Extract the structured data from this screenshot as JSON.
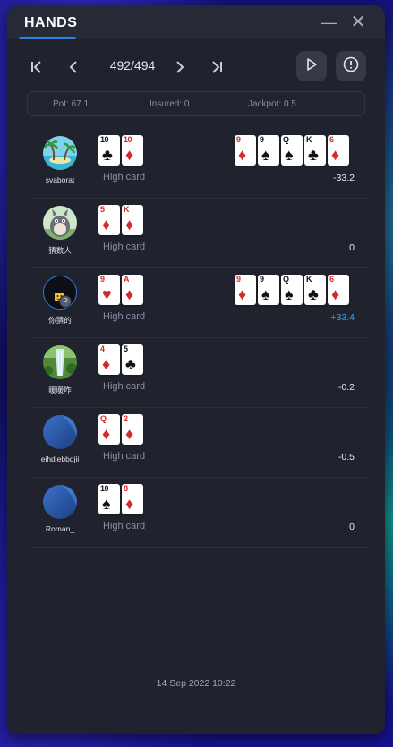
{
  "window": {
    "title": "HANDS"
  },
  "nav": {
    "counter": "492/494"
  },
  "info": {
    "pot": "Pot: 67.1",
    "insured": "Insured: 0",
    "jackpot": "Jackpot: 0.5"
  },
  "rows": [
    {
      "name": "svaborat",
      "hand": "High card",
      "result": "-33.2",
      "hole": [
        {
          "rank": "10",
          "suit": "♣",
          "color": "black"
        },
        {
          "rank": "10",
          "suit": "♦",
          "color": "red"
        }
      ],
      "board": [
        {
          "rank": "9",
          "suit": "♦",
          "color": "red"
        },
        {
          "rank": "9",
          "suit": "♠",
          "color": "black"
        },
        {
          "rank": "Q",
          "suit": "♠",
          "color": "black"
        },
        {
          "rank": "K",
          "suit": "♣",
          "color": "black"
        },
        {
          "rank": "6",
          "suit": "♦",
          "color": "red"
        }
      ]
    },
    {
      "name": "猜数人",
      "hand": "High card",
      "result": "0",
      "hole": [
        {
          "rank": "5",
          "suit": "♦",
          "color": "red"
        },
        {
          "rank": "K",
          "suit": "♦",
          "color": "red"
        }
      ],
      "board": []
    },
    {
      "name": "你猜的",
      "hand": "High card",
      "result": "+33.4",
      "badge": "D",
      "hole": [
        {
          "rank": "9",
          "suit": "♥",
          "color": "red"
        },
        {
          "rank": "A",
          "suit": "♦",
          "color": "red"
        }
      ],
      "board": [
        {
          "rank": "9",
          "suit": "♦",
          "color": "red"
        },
        {
          "rank": "9",
          "suit": "♠",
          "color": "black"
        },
        {
          "rank": "Q",
          "suit": "♠",
          "color": "black"
        },
        {
          "rank": "K",
          "suit": "♣",
          "color": "black"
        },
        {
          "rank": "6",
          "suit": "♦",
          "color": "red"
        }
      ]
    },
    {
      "name": "暖暖咋",
      "hand": "High card",
      "result": "-0.2",
      "hole": [
        {
          "rank": "4",
          "suit": "♦",
          "color": "red"
        },
        {
          "rank": "5",
          "suit": "♣",
          "color": "black"
        }
      ],
      "board": []
    },
    {
      "name": "eihdiebbdjii",
      "hand": "High card",
      "result": "-0.5",
      "hole": [
        {
          "rank": "Q",
          "suit": "♦",
          "color": "red"
        },
        {
          "rank": "2",
          "suit": "♦",
          "color": "red"
        }
      ],
      "board": []
    },
    {
      "name": "Roman_",
      "hand": "High card",
      "result": "0",
      "hole": [
        {
          "rank": "10",
          "suit": "♠",
          "color": "black"
        },
        {
          "rank": "8",
          "suit": "♦",
          "color": "red"
        }
      ],
      "board": []
    }
  ],
  "footer": {
    "timestamp": "14 Sep 2022 10:22"
  },
  "colors": {
    "panel": "#20232e",
    "accent": "#2f7fe0",
    "win": "#3d9bf0"
  },
  "icons": [
    "minimize-icon",
    "close-icon",
    "first-hand-icon",
    "prev-hand-icon",
    "next-hand-icon",
    "last-hand-icon",
    "play-icon",
    "alert-icon"
  ]
}
